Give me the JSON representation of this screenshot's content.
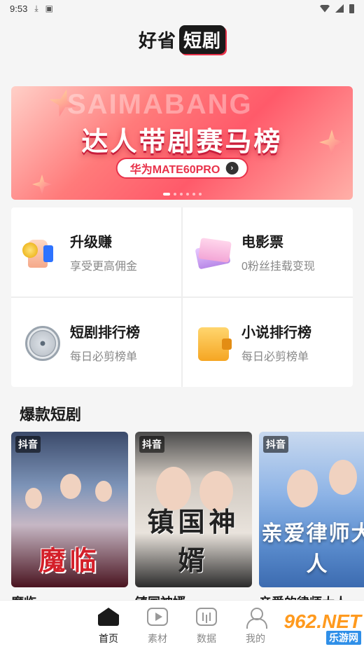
{
  "status_bar": {
    "time": "9:53",
    "download_icon": "download-icon",
    "app_icon": "a-icon"
  },
  "header": {
    "logo_part1": "好省",
    "logo_part2": "短剧"
  },
  "banner": {
    "bg_text": "SAIMABANG",
    "title": "达人带剧赛马榜",
    "pill_label": "华为MATE60PRO",
    "pill_arrow": "›",
    "dots_count": 6,
    "active_dot": 0
  },
  "grid": [
    {
      "title": "升级赚",
      "subtitle": "享受更高佣金",
      "icon": "thumbs-up-coin-icon"
    },
    {
      "title": "电影票",
      "subtitle": "0粉丝挂载变现",
      "icon": "movie-ticket-icon"
    },
    {
      "title": "短剧排行榜",
      "subtitle": "每日必剪榜单",
      "icon": "film-reel-icon"
    },
    {
      "title": "小说排行榜",
      "subtitle": "每日必剪榜单",
      "icon": "notebook-icon"
    }
  ],
  "section": {
    "title": "爆款短剧"
  },
  "dramas": [
    {
      "tag": "抖音",
      "poster_text": "魔临",
      "title": "魔临"
    },
    {
      "tag": "抖音",
      "poster_text": "镇国神婿",
      "title": "镇国神婿"
    },
    {
      "tag": "抖音",
      "poster_text": "亲爱律师大人",
      "title": "亲爱的律师大人"
    }
  ],
  "tabbar": {
    "tabs": [
      {
        "label": "首页",
        "icon": "home-icon",
        "active": true
      },
      {
        "label": "素材",
        "icon": "play-icon",
        "active": false
      },
      {
        "label": "数据",
        "icon": "chart-icon",
        "active": false
      },
      {
        "label": "我的",
        "icon": "user-icon",
        "active": false
      }
    ]
  },
  "watermark": {
    "top": "962.NET",
    "bottom": "乐游网"
  }
}
